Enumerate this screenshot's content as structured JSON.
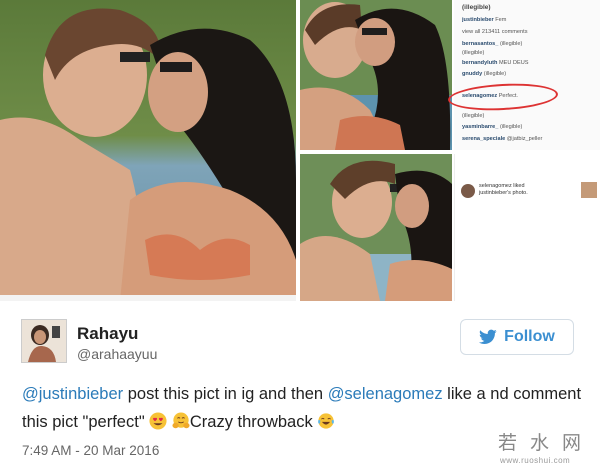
{
  "collage": {
    "instagram_comments": {
      "likes": "(illegible)",
      "lines": [
        {
          "user": "justinbieber",
          "text": "Fem"
        },
        {
          "user": "",
          "text": "view all 213411 comments"
        },
        {
          "user": "bernasantos_",
          "text": "(illegible)"
        },
        {
          "user": "",
          "text": "(illegible)"
        },
        {
          "user": "bernandyluth",
          "text": "MEU DEUS"
        },
        {
          "user": "gnuddy",
          "text": "(illegible)"
        },
        {
          "user": "selenagomez",
          "text": "Perfect."
        },
        {
          "user": "",
          "text": "(illegible)"
        },
        {
          "user": "yasminbarre_",
          "text": "(illegible)"
        },
        {
          "user": "serena_speciale",
          "text": "@jatbiz_peller"
        }
      ]
    },
    "instagram_activity": {
      "text_line1": "selenagomez liked",
      "text_line2": "justinbieber's photo."
    }
  },
  "tweet": {
    "name": "Rahayu",
    "handle": "@arahaayuu",
    "follow_label": "Follow",
    "text": {
      "mention1": "@justinbieber",
      "part1": " post this pict in ig and then ",
      "mention2": "@selenagomez",
      "part2": " like a nd comment this pict \"perfect\" ",
      "part3": "Crazy throwback "
    },
    "timestamp": "7:49 AM - 20 Mar 2016"
  },
  "watermark": {
    "chars": "若水网",
    "url": "www.ruoshui.com"
  },
  "icons": {
    "follow": "twitter-bird-icon",
    "emojis": [
      "heart-eyes-emoji-icon",
      "hugging-emoji-icon",
      "tears-of-joy-emoji-icon"
    ]
  },
  "colors": {
    "link": "#2b7bb9",
    "follow_text": "#3b8fd1",
    "circle": "#dd3333"
  }
}
